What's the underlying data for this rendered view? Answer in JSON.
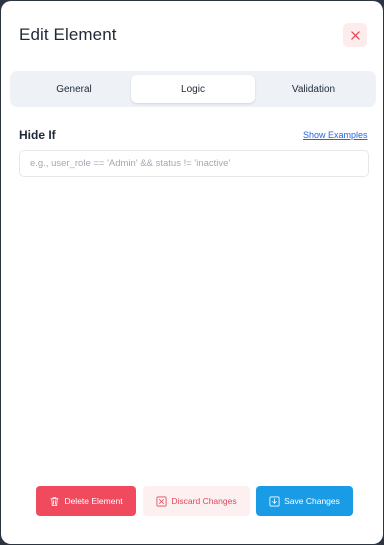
{
  "modal": {
    "title": "Edit Element",
    "close_icon": "close-icon"
  },
  "tabs": [
    {
      "label": "General",
      "active": false
    },
    {
      "label": "Logic",
      "active": true
    },
    {
      "label": "Validation",
      "active": false
    }
  ],
  "logic": {
    "hide_if_label": "Hide If",
    "show_examples_label": "Show Examples",
    "expression": {
      "value": "",
      "placeholder": "e.g., user_role == 'Admin' && status != 'inactive'"
    }
  },
  "footer": {
    "delete_label": "Delete Element",
    "delete_icon": "trash-icon",
    "discard_label": "Discard Changes",
    "discard_icon": "x-box-icon",
    "save_label": "Save Changes",
    "save_icon": "download-icon"
  },
  "colors": {
    "accent_blue": "#1a9be6",
    "danger": "#f04a5f",
    "danger_soft": "#fdf0f1",
    "link": "#2563eb"
  }
}
